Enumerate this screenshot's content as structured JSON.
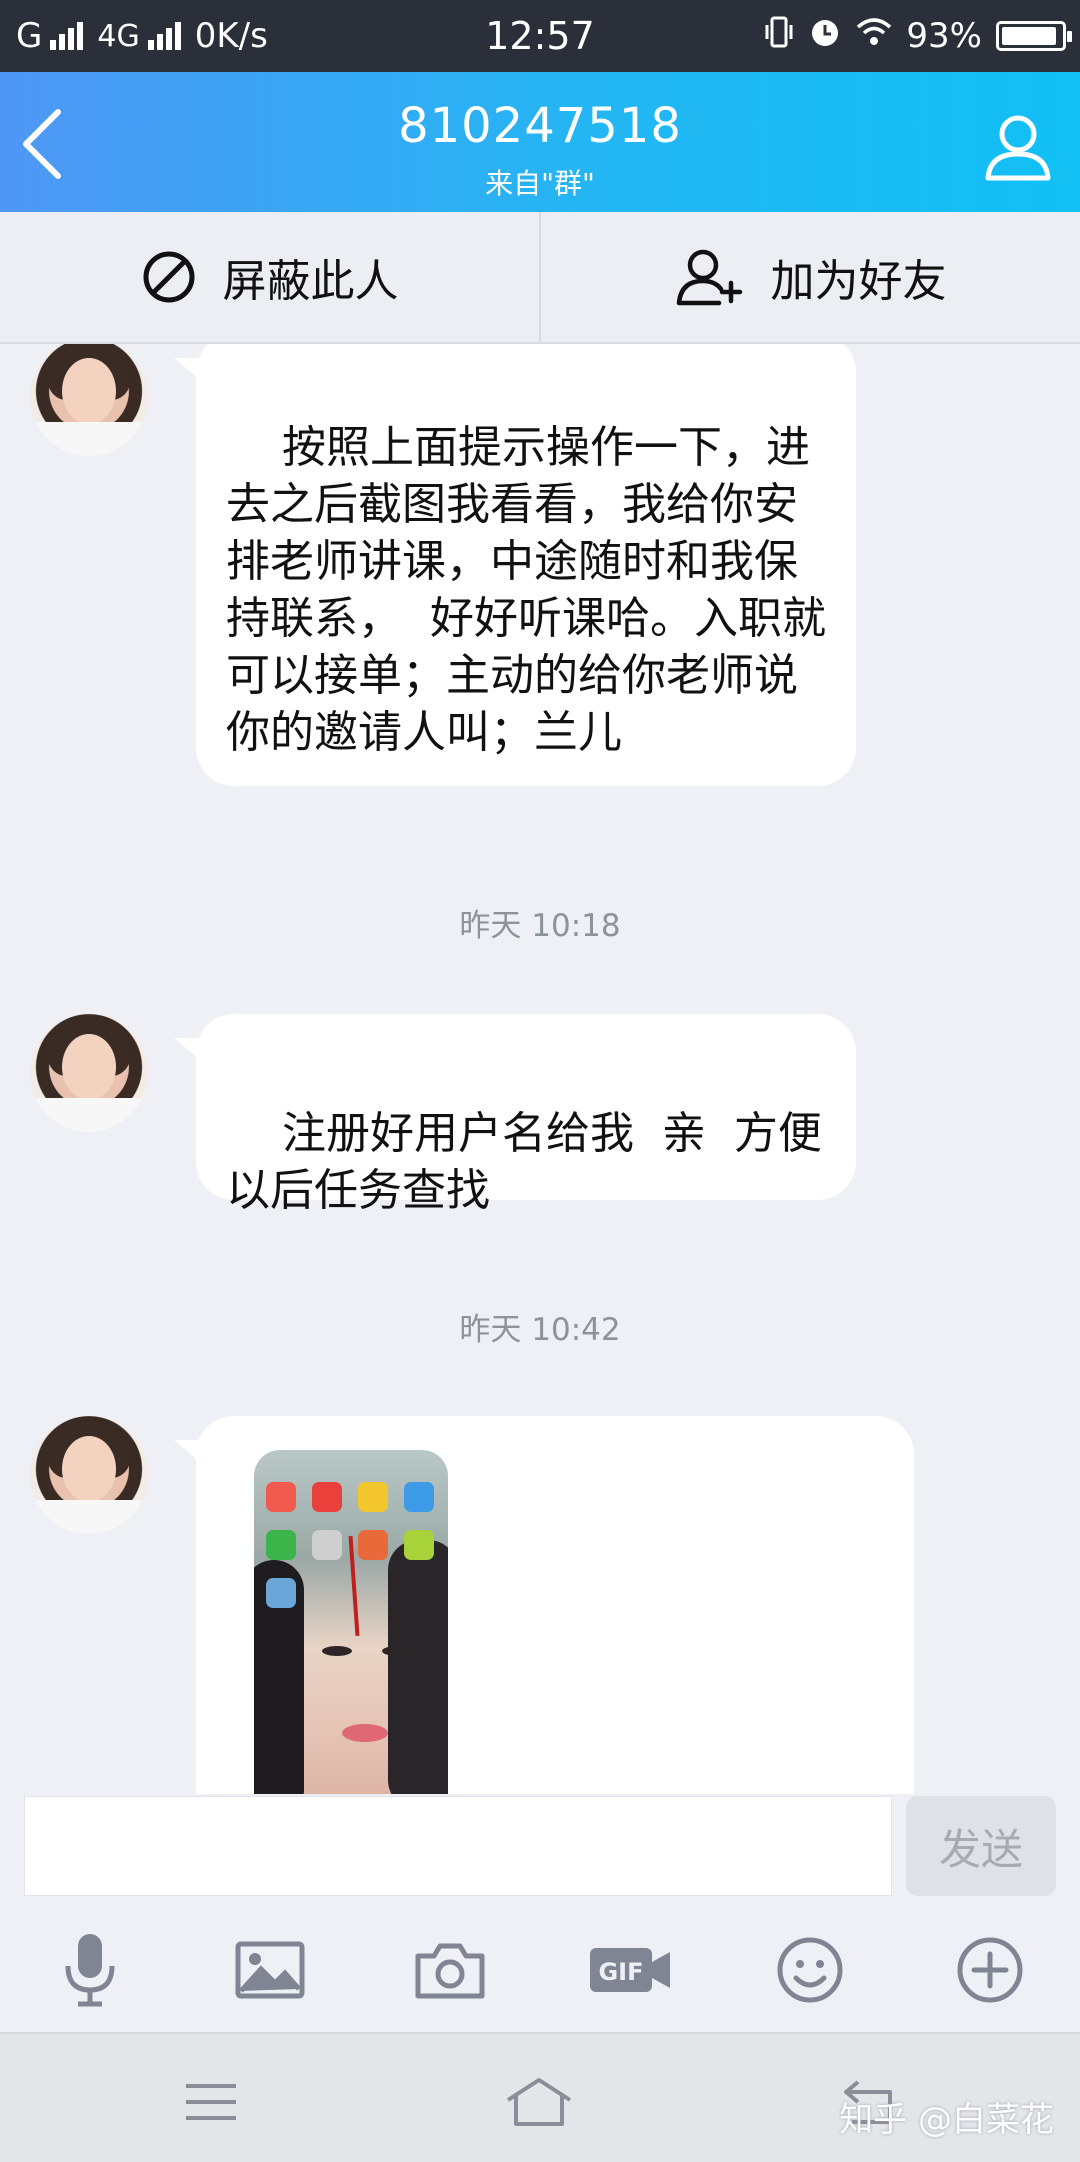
{
  "status_bar": {
    "network1": "G",
    "network2": "4G",
    "speed": "0K/s",
    "time": "12:57",
    "battery_text": "93%",
    "battery_level": 0.93
  },
  "header": {
    "title": "810247518",
    "subtitle": "来自\"群\""
  },
  "actions": {
    "block_label": "屏蔽此人",
    "add_friend_label": "加为好友"
  },
  "messages": [
    {
      "text": "按照上面提示操作一下，进去之后截图我看看，我给你安排老师讲课，中途随时和我保持联系，  好好听课哈。入职就可以接单；主动的给你老师说你的邀请人叫；兰儿"
    },
    {
      "text": "注册好用户名给我  亲  方便以后任务查找"
    }
  ],
  "timestamps": [
    "昨天 10:18",
    "昨天 10:42"
  ],
  "input": {
    "value": "",
    "placeholder": "",
    "send_label": "发送"
  },
  "toolbar_icons": [
    "microphone-icon",
    "image-icon",
    "camera-icon",
    "gif-icon",
    "emoji-icon",
    "plus-icon"
  ],
  "watermark": "知乎 @白菜花",
  "colors": {
    "header_start": "#4f97f5",
    "header_end": "#11c0f4",
    "status_bar": "#2b2f3a",
    "chat_background": "#eef0f5"
  }
}
